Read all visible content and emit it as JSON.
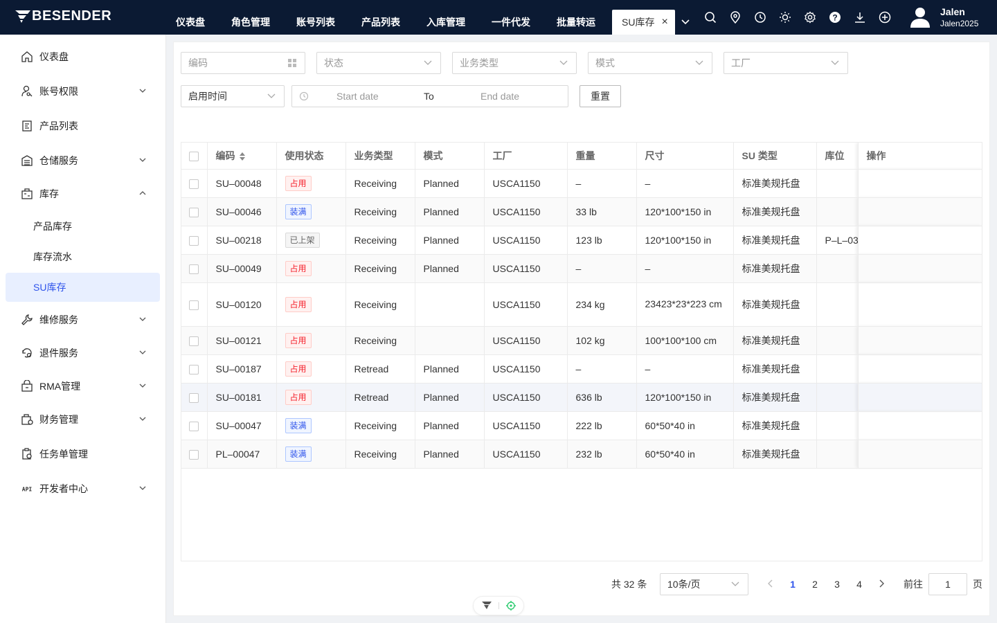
{
  "brand": "BESENDER",
  "nav": [
    "仪表盘",
    "角色管理",
    "账号列表",
    "产品列表",
    "入库管理",
    "一件代发",
    "批量转运"
  ],
  "active_tab": "SU库存",
  "user": {
    "name": "Jalen",
    "account": "Jalen2025"
  },
  "tool_icons": [
    "search-icon",
    "location-icon",
    "clock-icon",
    "sun-icon",
    "gear-icon",
    "help-icon",
    "download-icon",
    "plus-circle-icon"
  ],
  "sidebar": {
    "items": [
      {
        "label": "仪表盘",
        "icon": "home-icon"
      },
      {
        "label": "账号权限",
        "icon": "user-key-icon",
        "expand": "down"
      },
      {
        "label": "产品列表",
        "icon": "product-icon"
      },
      {
        "label": "仓储服务",
        "icon": "warehouse-icon",
        "expand": "down"
      },
      {
        "label": "库存",
        "icon": "inventory-icon",
        "expand": "up"
      },
      {
        "label": "产品库存",
        "sub": true
      },
      {
        "label": "库存流水",
        "sub": true
      },
      {
        "label": "SU库存",
        "sub": true,
        "selected": true
      },
      {
        "label": "维修服务",
        "icon": "wrench-icon",
        "expand": "down"
      },
      {
        "label": "退件服务",
        "icon": "return-icon",
        "expand": "down"
      },
      {
        "label": "RMA管理",
        "icon": "rma-icon",
        "expand": "down"
      },
      {
        "label": "财务管理",
        "icon": "finance-icon",
        "expand": "down"
      },
      {
        "label": "任务单管理",
        "icon": "task-icon"
      },
      {
        "label": "开发者中心",
        "icon": "api-icon",
        "expand": "down"
      }
    ]
  },
  "filters": {
    "code_placeholder": "编码",
    "status_placeholder": "状态",
    "business_placeholder": "业务类型",
    "mode_placeholder": "模式",
    "factory_placeholder": "工厂",
    "time_type": "启用时间",
    "start_placeholder": "Start date",
    "range_sep": "To",
    "end_placeholder": "End date",
    "reset_label": "重置"
  },
  "table": {
    "columns": [
      "编码",
      "使用状态",
      "业务类型",
      "模式",
      "工厂",
      "重量",
      "尺寸",
      "SU 类型",
      "库位",
      "操作"
    ],
    "rows": [
      {
        "code": "SU–00048",
        "status": "占用",
        "status_color": "red",
        "business": "Receiving",
        "mode": "Planned",
        "factory": "USCA1150",
        "weight": "–",
        "size": "–",
        "su_type": "标准美规托盘",
        "location": ""
      },
      {
        "code": "SU–00046",
        "status": "装满",
        "status_color": "blue",
        "business": "Receiving",
        "mode": "Planned",
        "factory": "USCA1150",
        "weight": "33 lb",
        "size": "120*100*150 in",
        "su_type": "标准美规托盘",
        "location": ""
      },
      {
        "code": "SU–00218",
        "status": "已上架",
        "status_color": "gray",
        "business": "Receiving",
        "mode": "Planned",
        "factory": "USCA1150",
        "weight": "123 lb",
        "size": "120*100*150 in",
        "su_type": "标准美规托盘",
        "location": "P–L–03"
      },
      {
        "code": "SU–00049",
        "status": "占用",
        "status_color": "red",
        "business": "Receiving",
        "mode": "Planned",
        "factory": "USCA1150",
        "weight": "–",
        "size": "–",
        "su_type": "标准美规托盘",
        "location": ""
      },
      {
        "code": "SU–00120",
        "status": "占用",
        "status_color": "red",
        "business": "Receiving",
        "mode": "",
        "factory": "USCA1150",
        "weight": "234 kg",
        "size": "23423*23*223 cm",
        "su_type": "标准美规托盘",
        "location": ""
      },
      {
        "code": "SU–00121",
        "status": "占用",
        "status_color": "red",
        "business": "Receiving",
        "mode": "",
        "factory": "USCA1150",
        "weight": "102 kg",
        "size": "100*100*100 cm",
        "su_type": "标准美规托盘",
        "location": ""
      },
      {
        "code": "SU–00187",
        "status": "占用",
        "status_color": "red",
        "business": "Retread",
        "mode": "Planned",
        "factory": "USCA1150",
        "weight": "–",
        "size": "–",
        "su_type": "标准美规托盘",
        "location": ""
      },
      {
        "code": "SU–00181",
        "status": "占用",
        "status_color": "red",
        "business": "Retread",
        "mode": "Planned",
        "factory": "USCA1150",
        "weight": "636 lb",
        "size": "120*100*150 in",
        "su_type": "标准美规托盘",
        "location": ""
      },
      {
        "code": "SU–00047",
        "status": "装满",
        "status_color": "blue",
        "business": "Receiving",
        "mode": "Planned",
        "factory": "USCA1150",
        "weight": "222 lb",
        "size": "60*50*40 in",
        "su_type": "标准美规托盘",
        "location": ""
      },
      {
        "code": "PL–00047",
        "status": "装满",
        "status_color": "blue",
        "business": "Receiving",
        "mode": "Planned",
        "factory": "USCA1150",
        "weight": "232 lb",
        "size": "60*50*40 in",
        "su_type": "标准美规托盘",
        "location": ""
      }
    ]
  },
  "pagination": {
    "total": "共 32 条",
    "page_size": "10条/页",
    "pages": [
      "1",
      "2",
      "3",
      "4"
    ],
    "current": "1",
    "goto_label": "前往",
    "goto_value": "1",
    "page_suffix": "页"
  },
  "colors": {
    "topbar": "#0b1a33",
    "accent": "#2f54eb",
    "selected_bg": "#e8efff"
  }
}
